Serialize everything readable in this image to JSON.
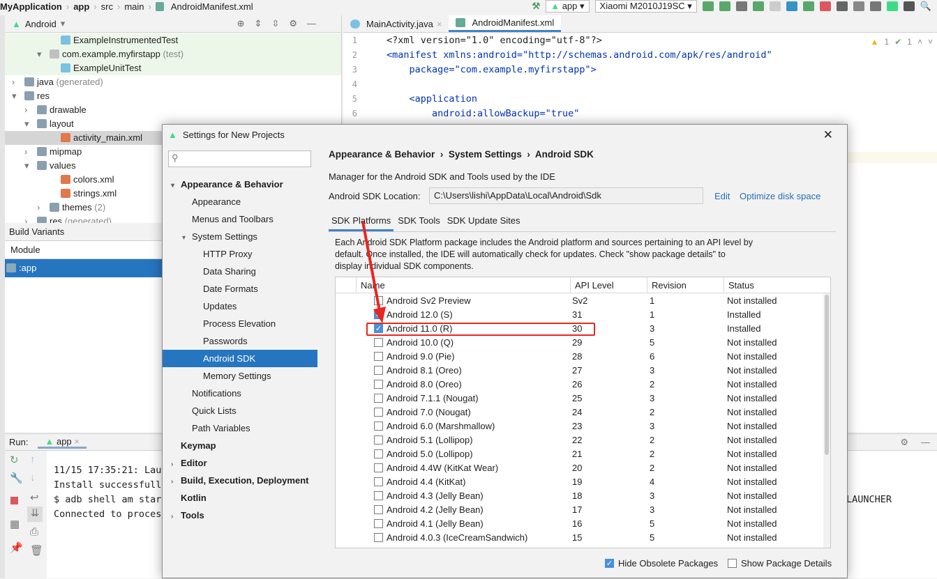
{
  "breadcrumb": [
    "MyApplication",
    "app",
    "src",
    "main",
    "AndroidManifest.xml"
  ],
  "toolbar": {
    "run_config": "app",
    "device": "Xiaomi M2010J19SC"
  },
  "project": {
    "view": "Android",
    "tree": [
      {
        "label": "ExampleInstrumentedTest",
        "extra": "",
        "indent": 80,
        "icon": "class"
      },
      {
        "label": "com.example.myfirstapp",
        "extra": "(test)",
        "indent": 64,
        "icon": "package"
      },
      {
        "label": "ExampleUnitTest",
        "extra": "",
        "indent": 80,
        "icon": "class"
      },
      {
        "label": "java",
        "extra": "(generated)",
        "indent": 28,
        "icon": "folder"
      },
      {
        "label": "res",
        "extra": "",
        "indent": 28,
        "icon": "folder"
      },
      {
        "label": "drawable",
        "extra": "",
        "indent": 46,
        "icon": "folder"
      },
      {
        "label": "layout",
        "extra": "",
        "indent": 46,
        "icon": "folder"
      },
      {
        "label": "activity_main.xml",
        "extra": "",
        "indent": 80,
        "icon": "xml"
      },
      {
        "label": "mipmap",
        "extra": "",
        "indent": 46,
        "icon": "folder"
      },
      {
        "label": "values",
        "extra": "",
        "indent": 46,
        "icon": "folder"
      },
      {
        "label": "colors.xml",
        "extra": "",
        "indent": 80,
        "icon": "xml"
      },
      {
        "label": "strings.xml",
        "extra": "",
        "indent": 80,
        "icon": "xml"
      },
      {
        "label": "themes",
        "extra": "(2)",
        "indent": 64,
        "icon": "folder"
      },
      {
        "label": "res",
        "extra": "(generated)",
        "indent": 46,
        "icon": "folder"
      }
    ]
  },
  "build_variants": {
    "title": "Build Variants",
    "column": "Module",
    "module": ":app"
  },
  "editor": {
    "tabs": [
      "MainActivity.java",
      "AndroidManifest.xml"
    ],
    "warnings": "1",
    "weak_warnings": "1",
    "lines": [
      "<?xml version=\"1.0\" encoding=\"utf-8\"?>",
      "<manifest xmlns:android=\"http://schemas.android.com/apk/res/android\"",
      "    package=\"com.example.myfirstapp\">",
      "",
      "    <application",
      "        android:allowBackup=\"true\""
    ]
  },
  "run": {
    "label": "Run:",
    "tab": "app",
    "console": [
      "11/15 17:35:21: Laun",
      "Install successfully",
      "$ adb shell am start",
      "Connected to process"
    ],
    "console_tail": "LAUNCHER"
  },
  "dialog": {
    "title": "Settings for New Projects",
    "search_placeholder": "",
    "nav": [
      {
        "label": "Appearance & Behavior",
        "level": 0,
        "bold": true,
        "arrow": "▾"
      },
      {
        "label": "Appearance",
        "level": 1
      },
      {
        "label": "Menus and Toolbars",
        "level": 1
      },
      {
        "label": "System Settings",
        "level": 1,
        "arrow": "▾"
      },
      {
        "label": "HTTP Proxy",
        "level": 2
      },
      {
        "label": "Data Sharing",
        "level": 2
      },
      {
        "label": "Date Formats",
        "level": 2
      },
      {
        "label": "Updates",
        "level": 2
      },
      {
        "label": "Process Elevation",
        "level": 2
      },
      {
        "label": "Passwords",
        "level": 2
      },
      {
        "label": "Android SDK",
        "level": 2,
        "selected": true
      },
      {
        "label": "Memory Settings",
        "level": 2
      },
      {
        "label": "Notifications",
        "level": 1
      },
      {
        "label": "Quick Lists",
        "level": 1
      },
      {
        "label": "Path Variables",
        "level": 1
      },
      {
        "label": "Keymap",
        "level": 0,
        "bold": true
      },
      {
        "label": "Editor",
        "level": 0,
        "bold": true,
        "arrow": "›"
      },
      {
        "label": "Build, Execution, Deployment",
        "level": 0,
        "bold": true,
        "arrow": "›"
      },
      {
        "label": "Kotlin",
        "level": 0,
        "bold": true
      },
      {
        "label": "Tools",
        "level": 0,
        "bold": true,
        "arrow": "›"
      }
    ],
    "path": [
      "Appearance & Behavior",
      "System Settings",
      "Android SDK"
    ],
    "description": "Manager for the Android SDK and Tools used by the IDE",
    "sdk_location_label": "Android SDK Location:",
    "sdk_location": "C:\\Users\\lishi\\AppData\\Local\\Android\\Sdk",
    "edit": "Edit",
    "optimize": "Optimize disk space",
    "tabs": [
      "SDK Platforms",
      "SDK Tools",
      "SDK Update Sites"
    ],
    "info": "Each Android SDK Platform package includes the Android platform and sources pertaining to an API level by default. Once installed, the IDE will automatically check for updates. Check \"show package details\" to display individual SDK components.",
    "columns": [
      "Name",
      "API Level",
      "Revision",
      "Status"
    ],
    "rows": [
      {
        "name": "Android Sv2 Preview",
        "api": "Sv2",
        "rev": "1",
        "status": "Not installed",
        "checked": false
      },
      {
        "name": "Android 12.0 (S)",
        "api": "31",
        "rev": "1",
        "status": "Installed",
        "checked": true
      },
      {
        "name": "Android 11.0 (R)",
        "api": "30",
        "rev": "3",
        "status": "Installed",
        "checked": true,
        "highlighted": true
      },
      {
        "name": "Android 10.0 (Q)",
        "api": "29",
        "rev": "5",
        "status": "Not installed",
        "checked": false
      },
      {
        "name": "Android 9.0 (Pie)",
        "api": "28",
        "rev": "6",
        "status": "Not installed",
        "checked": false
      },
      {
        "name": "Android 8.1 (Oreo)",
        "api": "27",
        "rev": "3",
        "status": "Not installed",
        "checked": false
      },
      {
        "name": "Android 8.0 (Oreo)",
        "api": "26",
        "rev": "2",
        "status": "Not installed",
        "checked": false
      },
      {
        "name": "Android 7.1.1 (Nougat)",
        "api": "25",
        "rev": "3",
        "status": "Not installed",
        "checked": false
      },
      {
        "name": "Android 7.0 (Nougat)",
        "api": "24",
        "rev": "2",
        "status": "Not installed",
        "checked": false
      },
      {
        "name": "Android 6.0 (Marshmallow)",
        "api": "23",
        "rev": "3",
        "status": "Not installed",
        "checked": false
      },
      {
        "name": "Android 5.1 (Lollipop)",
        "api": "22",
        "rev": "2",
        "status": "Not installed",
        "checked": false
      },
      {
        "name": "Android 5.0 (Lollipop)",
        "api": "21",
        "rev": "2",
        "status": "Not installed",
        "checked": false
      },
      {
        "name": "Android 4.4W (KitKat Wear)",
        "api": "20",
        "rev": "2",
        "status": "Not installed",
        "checked": false
      },
      {
        "name": "Android 4.4 (KitKat)",
        "api": "19",
        "rev": "4",
        "status": "Not installed",
        "checked": false
      },
      {
        "name": "Android 4.3 (Jelly Bean)",
        "api": "18",
        "rev": "3",
        "status": "Not installed",
        "checked": false
      },
      {
        "name": "Android 4.2 (Jelly Bean)",
        "api": "17",
        "rev": "3",
        "status": "Not installed",
        "checked": false
      },
      {
        "name": "Android 4.1 (Jelly Bean)",
        "api": "16",
        "rev": "5",
        "status": "Not installed",
        "checked": false
      },
      {
        "name": "Android 4.0.3 (IceCreamSandwich)",
        "api": "15",
        "rev": "5",
        "status": "Not installed",
        "checked": false
      }
    ],
    "hide_obsolete": {
      "label": "Hide Obsolete Packages",
      "checked": true
    },
    "show_details": {
      "label": "Show Package Details",
      "checked": false
    }
  },
  "colors": {
    "accent": "#2675bf",
    "annotation": "#e8261f",
    "android_green": "#3ddc84"
  }
}
